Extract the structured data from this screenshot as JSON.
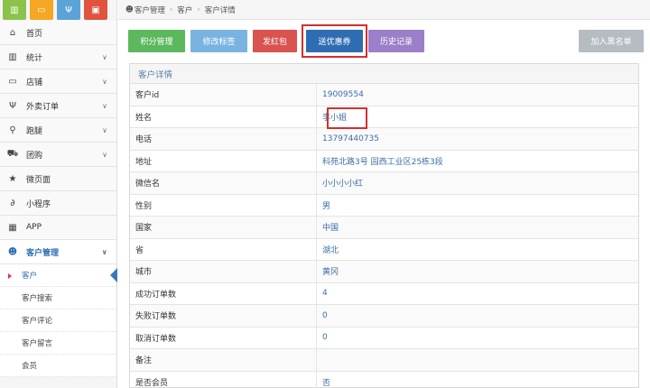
{
  "shortcuts": [
    {
      "icon": "bar-chart-icon",
      "glyph": "▥",
      "color": "#8bc34a"
    },
    {
      "icon": "monitor-icon",
      "glyph": "▭",
      "color": "#f5a623"
    },
    {
      "icon": "fork-knife-icon",
      "glyph": "Ψ",
      "color": "#5aa2d8"
    },
    {
      "icon": "bag-icon",
      "glyph": "▣",
      "color": "#e0533d"
    }
  ],
  "sidebar": {
    "items": [
      {
        "label": "首页",
        "glyph": "⌂",
        "icon": "home-icon",
        "chevron": false
      },
      {
        "label": "统计",
        "glyph": "▥",
        "icon": "stats-icon",
        "chevron": true
      },
      {
        "label": "店铺",
        "glyph": "▭",
        "icon": "store-icon",
        "chevron": true
      },
      {
        "label": "外卖订单",
        "glyph": "Ψ",
        "icon": "takeout-icon",
        "chevron": true
      },
      {
        "label": "跑腿",
        "glyph": "⚲",
        "icon": "bike-icon",
        "chevron": true
      },
      {
        "label": "团购",
        "glyph": "⛟",
        "icon": "cart-icon",
        "chevron": true
      },
      {
        "label": "微页面",
        "glyph": "★",
        "icon": "star-icon",
        "chevron": false
      },
      {
        "label": "小程序",
        "glyph": "∂",
        "icon": "miniapp-icon",
        "chevron": false
      },
      {
        "label": "APP",
        "glyph": "▦",
        "icon": "grid-icon",
        "chevron": false
      },
      {
        "label": "客户管理",
        "glyph": "☻",
        "icon": "users-icon",
        "chevron": true
      }
    ],
    "subitems": [
      "客户",
      "客户搜索",
      "客户评论",
      "客户留言",
      "会员"
    ]
  },
  "breadcrumb": {
    "root": "客户管理",
    "level2": "客户",
    "level3": "客户详情"
  },
  "toolbar": {
    "points": "积分管理",
    "tags": "修改标签",
    "redpacket": "发红包",
    "coupon": "送优惠券",
    "history": "历史记录",
    "blacklist": "加入黑名单"
  },
  "panel": {
    "title": "客户详情",
    "rows": [
      {
        "label": "客户id",
        "value": "19009554"
      },
      {
        "label": "姓名",
        "value": "李小姐"
      },
      {
        "label": "电话",
        "value": "13797440735"
      },
      {
        "label": "地址",
        "value": "科苑北路3号 园西工业区25栋3段"
      },
      {
        "label": "微信名",
        "value": "小小小小红"
      },
      {
        "label": "性别",
        "value": "男"
      },
      {
        "label": "国家",
        "value": "中国"
      },
      {
        "label": "省",
        "value": "湖北"
      },
      {
        "label": "城市",
        "value": "黄冈"
      },
      {
        "label": "成功订单数",
        "value": "4"
      },
      {
        "label": "失败订单数",
        "value": "0"
      },
      {
        "label": "取消订单数",
        "value": "0"
      },
      {
        "label": "备注",
        "value": ""
      },
      {
        "label": "是否会员",
        "value": "否"
      }
    ]
  },
  "colors": {
    "points": "#5cb85c",
    "tags": "#79b4e0",
    "redpacket": "#d9534f",
    "coupon": "#2f6db3",
    "history": "#9b7fc8",
    "blacklist": "#b6bcc2",
    "highlight": "#d62e2e"
  }
}
